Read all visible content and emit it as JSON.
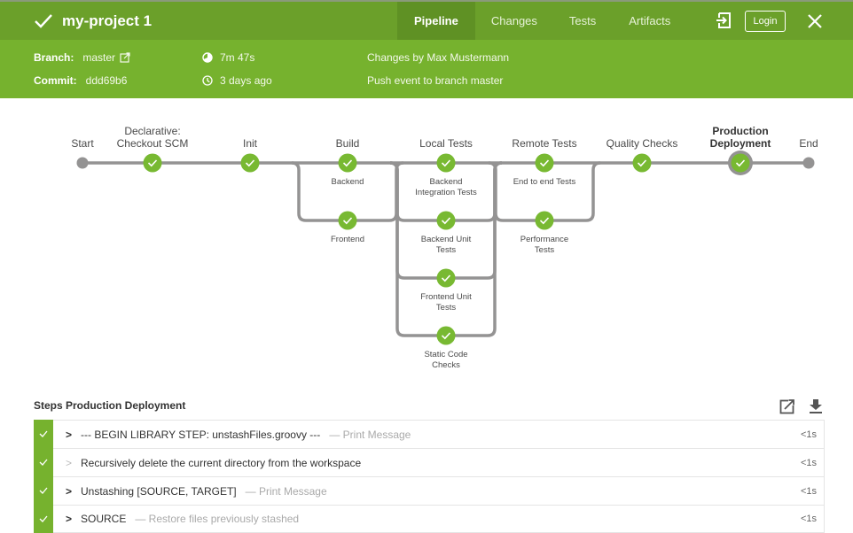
{
  "header": {
    "title": "my-project 1",
    "status": "success",
    "tabs": [
      {
        "label": "Pipeline",
        "active": true
      },
      {
        "label": "Changes",
        "active": false
      },
      {
        "label": "Tests",
        "active": false
      },
      {
        "label": "Artifacts",
        "active": false
      }
    ],
    "login_label": "Login",
    "icons": {
      "exit": "exit-icon",
      "close": "close-icon",
      "check": "check-icon"
    }
  },
  "info": {
    "branch_label": "Branch:",
    "branch_value": "master",
    "commit_label": "Commit:",
    "commit_value": "ddd69b6",
    "duration": "7m 47s",
    "started": "3 days ago",
    "changes": "Changes by Max Mustermann",
    "cause": "Push event to branch master"
  },
  "pipeline": {
    "start_label": "Start",
    "end_label": "End",
    "stages": [
      {
        "name": "Declarative: Checkout SCM",
        "lines": [
          "Declarative:",
          "Checkout SCM"
        ],
        "status": "success",
        "parallel": []
      },
      {
        "name": "Init",
        "lines": [
          "Init"
        ],
        "status": "success",
        "parallel": []
      },
      {
        "name": "Build",
        "lines": [
          "Build"
        ],
        "status": "success",
        "parallel": [
          {
            "lines": [
              "Backend"
            ]
          },
          {
            "lines": [
              "Frontend"
            ]
          }
        ]
      },
      {
        "name": "Local Tests",
        "lines": [
          "Local Tests"
        ],
        "status": "success",
        "parallel": [
          {
            "lines": [
              "Backend",
              "Integration Tests"
            ]
          },
          {
            "lines": [
              "Backend Unit",
              "Tests"
            ]
          },
          {
            "lines": [
              "Frontend Unit",
              "Tests"
            ]
          },
          {
            "lines": [
              "Static Code",
              "Checks"
            ]
          }
        ]
      },
      {
        "name": "Remote Tests",
        "lines": [
          "Remote Tests"
        ],
        "status": "success",
        "parallel": [
          {
            "lines": [
              "End to end Tests"
            ]
          },
          {
            "lines": [
              "Performance",
              "Tests"
            ]
          }
        ]
      },
      {
        "name": "Quality Checks",
        "lines": [
          "Quality Checks"
        ],
        "status": "success",
        "parallel": []
      },
      {
        "name": "Production Deployment",
        "lines": [
          "Production",
          "Deployment"
        ],
        "status": "success",
        "selected": true,
        "parallel": []
      }
    ]
  },
  "steps": {
    "title": "Steps Production Deployment",
    "items": [
      {
        "text": "--- BEGIN LIBRARY STEP: unstashFiles.groovy ---",
        "desc": "— Print Message",
        "duration": "<1s",
        "expandable": true
      },
      {
        "text": "Recursively delete the current directory from the workspace",
        "desc": "",
        "duration": "<1s",
        "expandable": false
      },
      {
        "text": "Unstashing [SOURCE, TARGET]",
        "desc": "— Print Message",
        "duration": "<1s",
        "expandable": true
      },
      {
        "text": "SOURCE",
        "desc": "— Restore files previously stashed",
        "duration": "<1s",
        "expandable": true
      }
    ]
  },
  "colors": {
    "success": "#78b932",
    "header": "#6ba02a",
    "subheader": "#76b22e",
    "line": "#949393"
  }
}
